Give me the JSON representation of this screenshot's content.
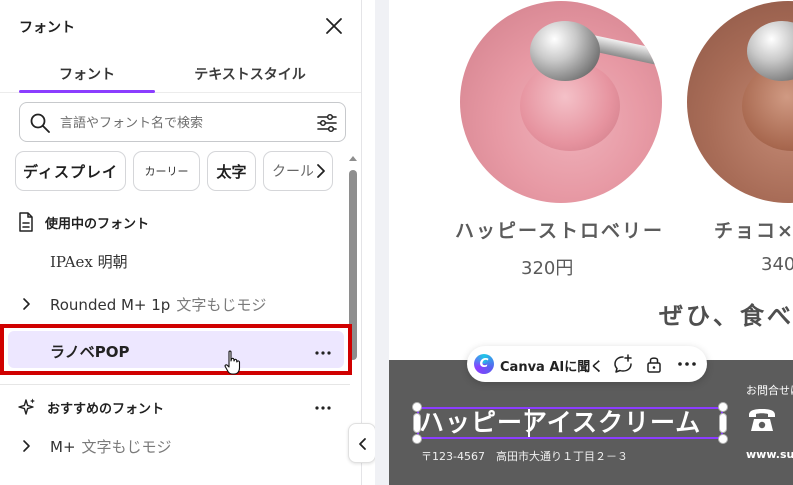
{
  "panel": {
    "title": "フォント",
    "tabs": [
      {
        "label": "フォント",
        "active": true
      },
      {
        "label": "テキストスタイル",
        "active": false
      }
    ],
    "search": {
      "placeholder": "言語やフォント名で検索",
      "value": ""
    },
    "chips": [
      "ディスプレイ",
      "カーリー",
      "太字",
      "クール"
    ],
    "used_section": {
      "title": "使用中のフォント",
      "fonts": [
        {
          "name": "IPAex 明朝",
          "sub": "",
          "expandable": false
        },
        {
          "name": "Rounded M+ 1p",
          "sub": "文字もじモジ",
          "expandable": true
        },
        {
          "name": "ラノベPOP",
          "sub": "",
          "expandable": false,
          "selected": true
        }
      ]
    },
    "recommended_section": {
      "title": "おすすめのフォント",
      "fonts": [
        {
          "name": "M+",
          "sub": "文字もじモジ",
          "expandable": true
        }
      ]
    }
  },
  "canvas": {
    "products": [
      {
        "name": "ハッピーストロベリー",
        "price": "320円"
      },
      {
        "name": "チョコ×",
        "price": "340"
      }
    ],
    "tagline": "ぜひ、食べ",
    "ai_toolbar": {
      "label": "Canva AIに聞く",
      "logo_letter": "C"
    },
    "shop_name": "ハッピーアイスクリーム",
    "address": "〒123-4567　高田市大通り１丁目２－３",
    "contact_label": "お問合せは",
    "url": "www.sub"
  },
  "colors": {
    "accent": "#8b3dff",
    "selection_highlight": "#ede7ff",
    "callout_border": "#d00000",
    "footer_band": "#5c5c5c"
  }
}
